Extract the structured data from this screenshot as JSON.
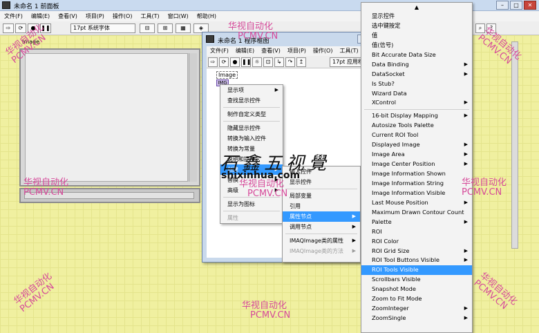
{
  "front_panel": {
    "title": "未命名 1 前面板",
    "menu": [
      "文件(F)",
      "编辑(E)",
      "查看(V)",
      "项目(P)",
      "操作(O)",
      "工具(T)",
      "窗口(W)",
      "帮助(H)"
    ],
    "font_select": "17pt 系统字体",
    "image_label": "Image"
  },
  "block_diagram": {
    "title": "未命名 1 程序框图",
    "menu": [
      "文件(F)",
      "编辑(E)",
      "查看(V)",
      "项目(P)",
      "操作(O)",
      "工具(T)"
    ],
    "font_select": "17pt 应用程",
    "terminal_label": "Image",
    "terminal_icon": "IMG"
  },
  "context_menu_1": {
    "items": [
      {
        "label": "显示项",
        "submenu": true,
        "disabled": false
      },
      {
        "label": "查找显示控件",
        "submenu": false,
        "disabled": false
      },
      {
        "sep": true
      },
      {
        "label": "制作自定义类型",
        "submenu": false,
        "disabled": false
      },
      {
        "sep": true
      },
      {
        "label": "隐藏显示控件",
        "submenu": false,
        "disabled": false
      },
      {
        "label": "转换为输入控件",
        "submenu": false,
        "disabled": false
      },
      {
        "label": "转换为常量",
        "submenu": false,
        "disabled": false
      },
      {
        "label": "说明和提示...",
        "submenu": false,
        "disabled": false
      },
      {
        "label": "创建",
        "submenu": true,
        "disabled": false,
        "highlight": true
      },
      {
        "label": "替换",
        "submenu": true,
        "disabled": false
      },
      {
        "label": "高级",
        "submenu": true,
        "disabled": false
      },
      {
        "sep": true
      },
      {
        "label": "显示为图标",
        "submenu": false,
        "disabled": false
      },
      {
        "sep": true
      },
      {
        "label": "属性",
        "submenu": false,
        "disabled": true
      }
    ]
  },
  "context_menu_2": {
    "items": [
      {
        "label": "输入控件",
        "submenu": false,
        "disabled": false
      },
      {
        "label": "显示控件",
        "submenu": false,
        "disabled": false
      },
      {
        "sep": true
      },
      {
        "label": "局部变量",
        "submenu": false,
        "disabled": false
      },
      {
        "label": "引用",
        "submenu": false,
        "disabled": false
      },
      {
        "label": "属性节点",
        "submenu": true,
        "disabled": false,
        "highlight": true
      },
      {
        "label": "调用节点",
        "submenu": true,
        "disabled": false
      },
      {
        "sep": true
      },
      {
        "label": "IMAQImage类的属性",
        "submenu": true,
        "disabled": false
      },
      {
        "label": "IMAQImage类的方法",
        "submenu": true,
        "disabled": true
      }
    ]
  },
  "context_menu_3": {
    "items": [
      {
        "label": "显示控件",
        "submenu": false
      },
      {
        "label": "选中键按定",
        "submenu": false
      },
      {
        "label": "值",
        "submenu": false
      },
      {
        "label": "值(信号)",
        "submenu": false
      },
      {
        "label": "Bit Accurate Data Size",
        "submenu": false
      },
      {
        "label": "Data Binding",
        "submenu": true
      },
      {
        "label": "DataSocket",
        "submenu": true
      },
      {
        "label": "Is Stub?",
        "submenu": false
      },
      {
        "label": "Wizard Data",
        "submenu": false
      },
      {
        "label": "XControl",
        "submenu": true
      },
      {
        "sep": true
      },
      {
        "label": "16-bit Display Mapping",
        "submenu": true
      },
      {
        "label": "Autosize Tools Palette",
        "submenu": false
      },
      {
        "label": "Current ROI Tool",
        "submenu": false
      },
      {
        "label": "Displayed Image",
        "submenu": true
      },
      {
        "label": "Image Area",
        "submenu": true
      },
      {
        "label": "Image Center Position",
        "submenu": true
      },
      {
        "label": "Image Information Shown",
        "submenu": false
      },
      {
        "label": "Image Information String",
        "submenu": false
      },
      {
        "label": "Image Information Visible",
        "submenu": false
      },
      {
        "label": "Last Mouse Position",
        "submenu": true
      },
      {
        "label": "Maximum Drawn Contour Count",
        "submenu": false
      },
      {
        "label": "Palette",
        "submenu": true
      },
      {
        "label": "ROI",
        "submenu": false
      },
      {
        "label": "ROI Color",
        "submenu": false
      },
      {
        "label": "ROI Grid Size",
        "submenu": true
      },
      {
        "label": "ROI Tool Buttons Visible",
        "submenu": true
      },
      {
        "label": "ROI Tools Visible",
        "submenu": false,
        "highlight": true
      },
      {
        "label": "Scrollbars Visible",
        "submenu": false
      },
      {
        "label": "Snapshot Mode",
        "submenu": false
      },
      {
        "label": "Zoom to Fit Mode",
        "submenu": false
      },
      {
        "label": "ZoomInteger",
        "submenu": true
      },
      {
        "label": "ZoomSingle",
        "submenu": true
      }
    ]
  },
  "watermark": {
    "cn": "华视自动化",
    "en": "PCMV.CN",
    "brand_cn": "石鑫五视覺",
    "brand_url": "shixinhua.com"
  }
}
